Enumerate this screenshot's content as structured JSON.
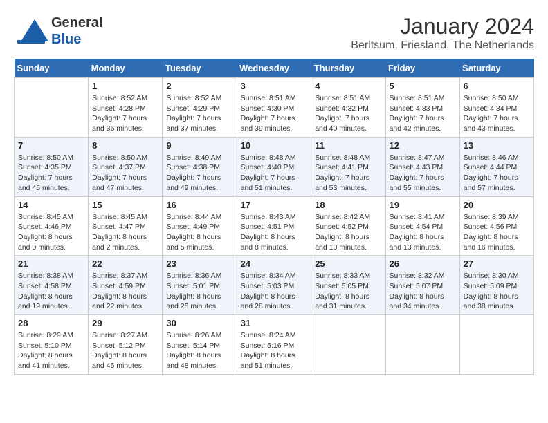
{
  "header": {
    "logo_general": "General",
    "logo_blue": "Blue",
    "month_year": "January 2024",
    "location": "Berltsum, Friesland, The Netherlands"
  },
  "calendar": {
    "day_headers": [
      "Sunday",
      "Monday",
      "Tuesday",
      "Wednesday",
      "Thursday",
      "Friday",
      "Saturday"
    ],
    "weeks": [
      [
        {
          "day": "",
          "info": ""
        },
        {
          "day": "1",
          "info": "Sunrise: 8:52 AM\nSunset: 4:28 PM\nDaylight: 7 hours\nand 36 minutes."
        },
        {
          "day": "2",
          "info": "Sunrise: 8:52 AM\nSunset: 4:29 PM\nDaylight: 7 hours\nand 37 minutes."
        },
        {
          "day": "3",
          "info": "Sunrise: 8:51 AM\nSunset: 4:30 PM\nDaylight: 7 hours\nand 39 minutes."
        },
        {
          "day": "4",
          "info": "Sunrise: 8:51 AM\nSunset: 4:32 PM\nDaylight: 7 hours\nand 40 minutes."
        },
        {
          "day": "5",
          "info": "Sunrise: 8:51 AM\nSunset: 4:33 PM\nDaylight: 7 hours\nand 42 minutes."
        },
        {
          "day": "6",
          "info": "Sunrise: 8:50 AM\nSunset: 4:34 PM\nDaylight: 7 hours\nand 43 minutes."
        }
      ],
      [
        {
          "day": "7",
          "info": "Sunrise: 8:50 AM\nSunset: 4:35 PM\nDaylight: 7 hours\nand 45 minutes."
        },
        {
          "day": "8",
          "info": "Sunrise: 8:50 AM\nSunset: 4:37 PM\nDaylight: 7 hours\nand 47 minutes."
        },
        {
          "day": "9",
          "info": "Sunrise: 8:49 AM\nSunset: 4:38 PM\nDaylight: 7 hours\nand 49 minutes."
        },
        {
          "day": "10",
          "info": "Sunrise: 8:48 AM\nSunset: 4:40 PM\nDaylight: 7 hours\nand 51 minutes."
        },
        {
          "day": "11",
          "info": "Sunrise: 8:48 AM\nSunset: 4:41 PM\nDaylight: 7 hours\nand 53 minutes."
        },
        {
          "day": "12",
          "info": "Sunrise: 8:47 AM\nSunset: 4:43 PM\nDaylight: 7 hours\nand 55 minutes."
        },
        {
          "day": "13",
          "info": "Sunrise: 8:46 AM\nSunset: 4:44 PM\nDaylight: 7 hours\nand 57 minutes."
        }
      ],
      [
        {
          "day": "14",
          "info": "Sunrise: 8:45 AM\nSunset: 4:46 PM\nDaylight: 8 hours\nand 0 minutes."
        },
        {
          "day": "15",
          "info": "Sunrise: 8:45 AM\nSunset: 4:47 PM\nDaylight: 8 hours\nand 2 minutes."
        },
        {
          "day": "16",
          "info": "Sunrise: 8:44 AM\nSunset: 4:49 PM\nDaylight: 8 hours\nand 5 minutes."
        },
        {
          "day": "17",
          "info": "Sunrise: 8:43 AM\nSunset: 4:51 PM\nDaylight: 8 hours\nand 8 minutes."
        },
        {
          "day": "18",
          "info": "Sunrise: 8:42 AM\nSunset: 4:52 PM\nDaylight: 8 hours\nand 10 minutes."
        },
        {
          "day": "19",
          "info": "Sunrise: 8:41 AM\nSunset: 4:54 PM\nDaylight: 8 hours\nand 13 minutes."
        },
        {
          "day": "20",
          "info": "Sunrise: 8:39 AM\nSunset: 4:56 PM\nDaylight: 8 hours\nand 16 minutes."
        }
      ],
      [
        {
          "day": "21",
          "info": "Sunrise: 8:38 AM\nSunset: 4:58 PM\nDaylight: 8 hours\nand 19 minutes."
        },
        {
          "day": "22",
          "info": "Sunrise: 8:37 AM\nSunset: 4:59 PM\nDaylight: 8 hours\nand 22 minutes."
        },
        {
          "day": "23",
          "info": "Sunrise: 8:36 AM\nSunset: 5:01 PM\nDaylight: 8 hours\nand 25 minutes."
        },
        {
          "day": "24",
          "info": "Sunrise: 8:34 AM\nSunset: 5:03 PM\nDaylight: 8 hours\nand 28 minutes."
        },
        {
          "day": "25",
          "info": "Sunrise: 8:33 AM\nSunset: 5:05 PM\nDaylight: 8 hours\nand 31 minutes."
        },
        {
          "day": "26",
          "info": "Sunrise: 8:32 AM\nSunset: 5:07 PM\nDaylight: 8 hours\nand 34 minutes."
        },
        {
          "day": "27",
          "info": "Sunrise: 8:30 AM\nSunset: 5:09 PM\nDaylight: 8 hours\nand 38 minutes."
        }
      ],
      [
        {
          "day": "28",
          "info": "Sunrise: 8:29 AM\nSunset: 5:10 PM\nDaylight: 8 hours\nand 41 minutes."
        },
        {
          "day": "29",
          "info": "Sunrise: 8:27 AM\nSunset: 5:12 PM\nDaylight: 8 hours\nand 45 minutes."
        },
        {
          "day": "30",
          "info": "Sunrise: 8:26 AM\nSunset: 5:14 PM\nDaylight: 8 hours\nand 48 minutes."
        },
        {
          "day": "31",
          "info": "Sunrise: 8:24 AM\nSunset: 5:16 PM\nDaylight: 8 hours\nand 51 minutes."
        },
        {
          "day": "",
          "info": ""
        },
        {
          "day": "",
          "info": ""
        },
        {
          "day": "",
          "info": ""
        }
      ]
    ]
  }
}
